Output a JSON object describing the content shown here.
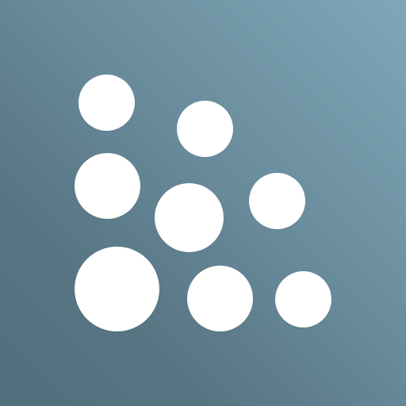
{
  "icon": {
    "name": "dots-logo-icon",
    "background_colors": [
      "#7fa7b8",
      "#6b8e9e",
      "#577482",
      "#50707e"
    ],
    "dot_color": "#ffffff",
    "dot_count": 8
  }
}
